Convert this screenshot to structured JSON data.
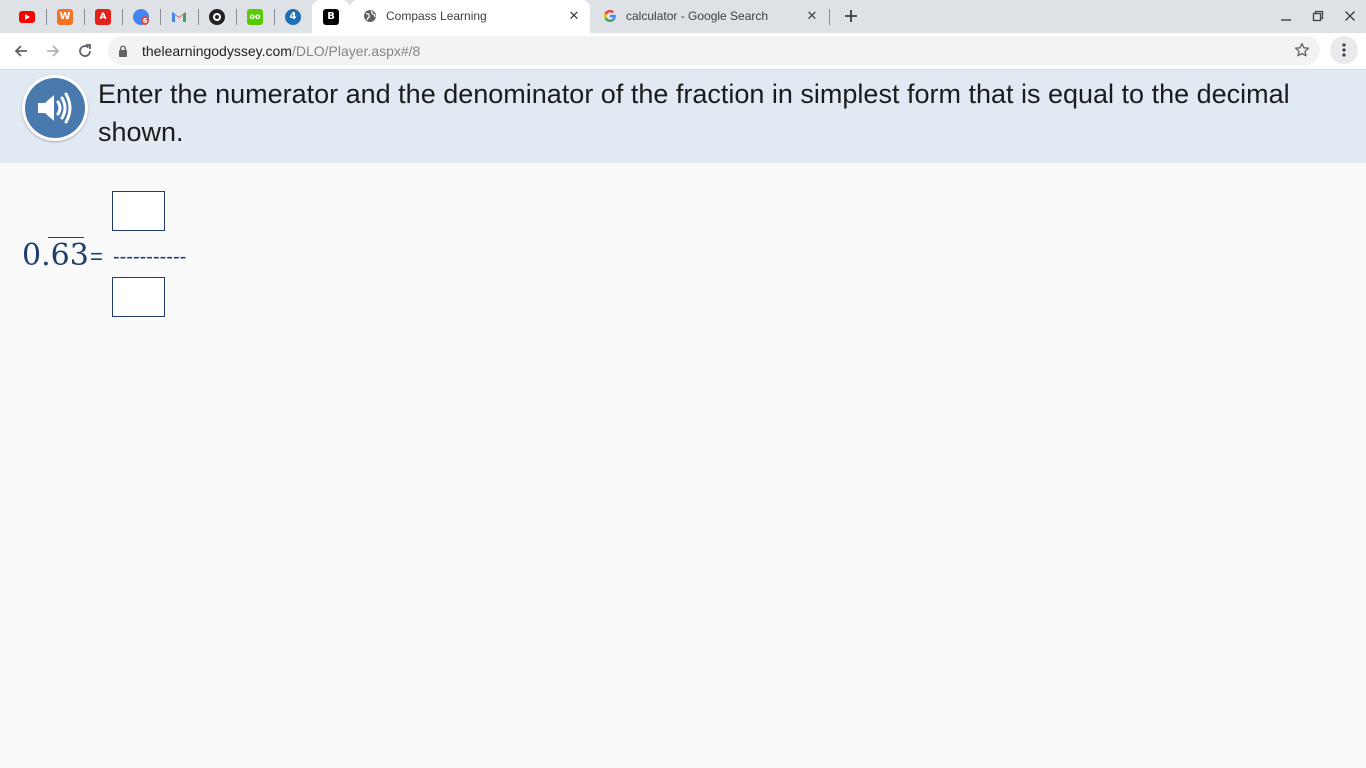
{
  "browser": {
    "pinned_tabs": [
      {
        "icon": "youtube-icon",
        "color": "#ff0000"
      },
      {
        "icon": "wattpad-icon",
        "color": "#f5731f",
        "glyph": "W"
      },
      {
        "icon": "adobe-icon",
        "color": "#e2211c"
      },
      {
        "icon": "classroom-icon",
        "color": "#4285f4",
        "glyph": "6"
      },
      {
        "icon": "gmail-icon",
        "color": "#ea4335",
        "glyph": "M"
      },
      {
        "icon": "target-icon",
        "color": "#222222"
      },
      {
        "icon": "duolingo-icon",
        "color": "#58cc02",
        "glyph": "oo"
      },
      {
        "icon": "app-icon",
        "color": "#1f6fb5",
        "glyph": "4"
      },
      {
        "icon": "bold-b-icon",
        "color": "#000000",
        "glyph": "B"
      }
    ],
    "tabs": [
      {
        "title": "Compass Learning",
        "active": true
      },
      {
        "title": "calculator - Google Search",
        "active": false
      }
    ],
    "url_domain": "thelearningodyssey.com",
    "url_path": "/DLO/Player.aspx#/8"
  },
  "page": {
    "instruction": "Enter the numerator and the denominator of the fraction in simplest form that is equal to the decimal shown.",
    "decimal_prefix": "0.",
    "repeating_digits": "63",
    "equals": "=",
    "fraction_bar": "-----------",
    "numerator_value": "",
    "denominator_value": ""
  },
  "colors": {
    "banner": "#e1e9f2",
    "audio_button": "#4a79ad",
    "math_text": "#1f3d6e"
  }
}
